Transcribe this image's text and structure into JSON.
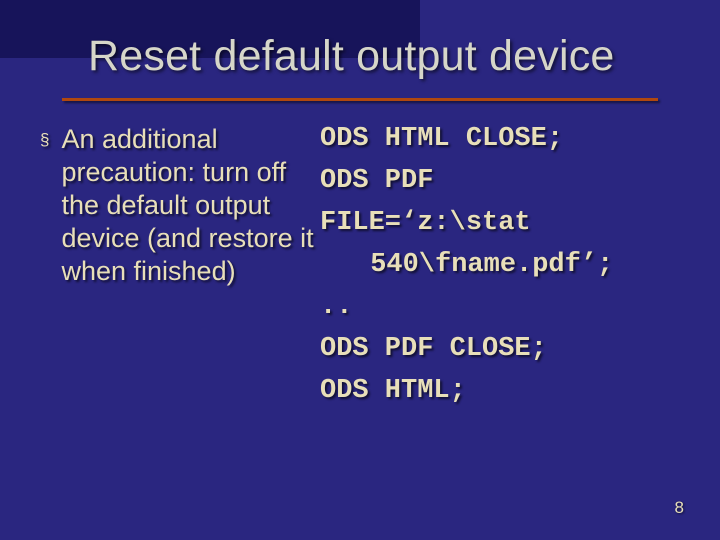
{
  "slide": {
    "title": "Reset default output device",
    "bullet_mark": "§",
    "bullet_text": "An additional precaution: turn off the default output device (and restore it when finished)",
    "code": {
      "l1": "ODS HTML CLOSE;",
      "l2": "ODS PDF",
      "l3": "FILE=‘z:\\stat",
      "l4": " 540\\fname.pdf’;",
      "l5": "..",
      "l6": "ODS PDF CLOSE;",
      "l7": "ODS HTML;"
    },
    "page_number": "8"
  }
}
